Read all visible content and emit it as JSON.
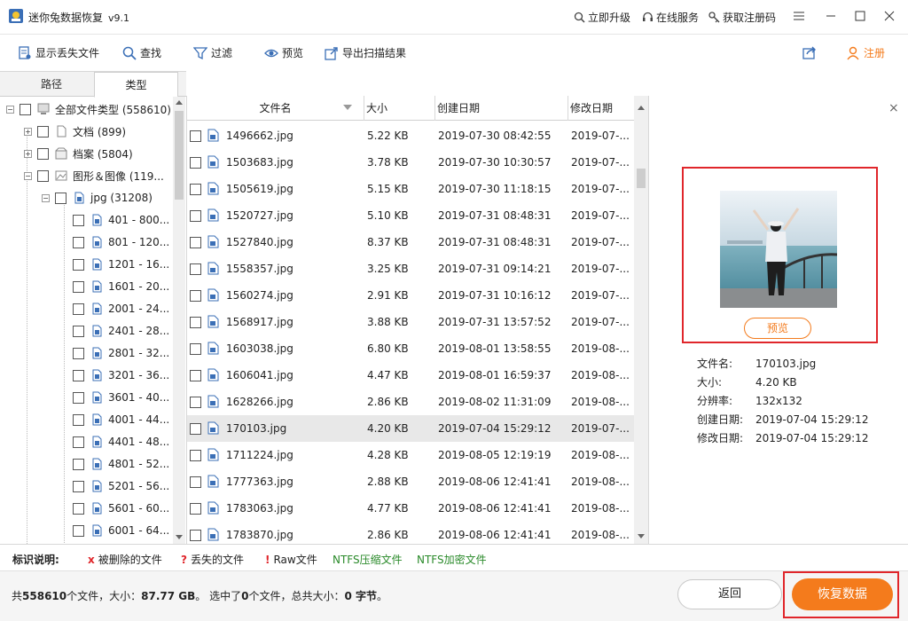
{
  "titlebar": {
    "title": "迷你兔数据恢复",
    "version": "v9.1",
    "upgrade": "立即升级",
    "online_service": "在线服务",
    "get_code": "获取注册码"
  },
  "toolbar": {
    "show_lost": "显示丢失文件",
    "find": "查找",
    "filter": "过滤",
    "preview": "预览",
    "export": "导出扫描结果",
    "register": "注册"
  },
  "left_tabs": {
    "path": "路径",
    "type": "类型"
  },
  "tree": {
    "root": "全部文件类型 (558610)",
    "documents": "文档 (899)",
    "archives": "档案 (5804)",
    "images": "图形＆图像 (119...",
    "jpg": "jpg (31208)",
    "ranges": [
      "401 - 800...",
      "801 - 120...",
      "1201 - 16...",
      "1601 - 20...",
      "2001 - 24...",
      "2401 - 28...",
      "2801 - 32...",
      "3201 - 36...",
      "3601 - 40...",
      "4001 - 44...",
      "4401 - 48...",
      "4801 - 52...",
      "5201 - 56...",
      "5601 - 60...",
      "6001 - 64..."
    ]
  },
  "list": {
    "headers": {
      "name": "文件名",
      "size": "大小",
      "created": "创建日期",
      "modified": "修改日期"
    },
    "rows": [
      {
        "name": "1496662.jpg",
        "size": "5.22 KB",
        "created": "2019-07-30 08:42:55",
        "modified": "2019-07-..."
      },
      {
        "name": "1503683.jpg",
        "size": "3.78 KB",
        "created": "2019-07-30 10:30:57",
        "modified": "2019-07-..."
      },
      {
        "name": "1505619.jpg",
        "size": "5.15 KB",
        "created": "2019-07-30 11:18:15",
        "modified": "2019-07-..."
      },
      {
        "name": "1520727.jpg",
        "size": "5.10 KB",
        "created": "2019-07-31 08:48:31",
        "modified": "2019-07-..."
      },
      {
        "name": "1527840.jpg",
        "size": "8.37 KB",
        "created": "2019-07-31 08:48:31",
        "modified": "2019-07-..."
      },
      {
        "name": "1558357.jpg",
        "size": "3.25 KB",
        "created": "2019-07-31 09:14:21",
        "modified": "2019-07-..."
      },
      {
        "name": "1560274.jpg",
        "size": "2.91 KB",
        "created": "2019-07-31 10:16:12",
        "modified": "2019-07-..."
      },
      {
        "name": "1568917.jpg",
        "size": "3.88 KB",
        "created": "2019-07-31 13:57:52",
        "modified": "2019-07-..."
      },
      {
        "name": "1603038.jpg",
        "size": "6.80 KB",
        "created": "2019-08-01 13:58:55",
        "modified": "2019-08-..."
      },
      {
        "name": "1606041.jpg",
        "size": "4.47 KB",
        "created": "2019-08-01 16:59:37",
        "modified": "2019-08-..."
      },
      {
        "name": "1628266.jpg",
        "size": "2.86 KB",
        "created": "2019-08-02 11:31:09",
        "modified": "2019-08-..."
      },
      {
        "name": "170103.jpg",
        "size": "4.20 KB",
        "created": "2019-07-04 15:29:12",
        "modified": "2019-07-..."
      },
      {
        "name": "1711224.jpg",
        "size": "4.28 KB",
        "created": "2019-08-05 12:19:19",
        "modified": "2019-08-..."
      },
      {
        "name": "1777363.jpg",
        "size": "2.88 KB",
        "created": "2019-08-06 12:41:41",
        "modified": "2019-08-..."
      },
      {
        "name": "1783063.jpg",
        "size": "4.77 KB",
        "created": "2019-08-06 12:41:41",
        "modified": "2019-08-..."
      },
      {
        "name": "1783870.jpg",
        "size": "2.86 KB",
        "created": "2019-08-06 12:41:41",
        "modified": "2019-08-..."
      }
    ]
  },
  "preview": {
    "button": "预览",
    "filename_label": "文件名:",
    "filename": "170103.jpg",
    "size_label": "大小:",
    "size": "4.20 KB",
    "resolution_label": "分辨率:",
    "resolution": "132x132",
    "created_label": "创建日期:",
    "created": "2019-07-04 15:29:12",
    "modified_label": "修改日期:",
    "modified": "2019-07-04 15:29:12"
  },
  "legend": {
    "title": "标识说明:",
    "deleted_mark": "x",
    "deleted": "被删除的文件",
    "lost_mark": "?",
    "lost": "丢失的文件",
    "raw_mark": "!",
    "raw": "Raw文件",
    "ntfs_compressed": "NTFS压缩文件",
    "ntfs_encrypted": "NTFS加密文件"
  },
  "status": {
    "p1": "共",
    "total_files": "558610",
    "p2": "个文件，大小：",
    "total_size": "87.77 GB",
    "p3": "。 选中了",
    "selected_files": "0",
    "p4": "个文件，总共大小：",
    "selected_size": "0 字节",
    "p5": "。"
  },
  "buttons": {
    "back": "返回",
    "recover": "恢复数据"
  },
  "colors": {
    "accent": "#f47b1c",
    "highlight": "#e0262b",
    "ntfs": "#2a8a2a"
  }
}
